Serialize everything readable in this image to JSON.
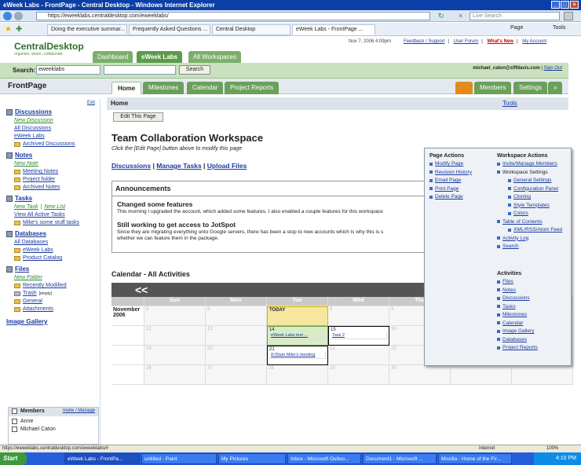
{
  "window": {
    "title": "eWeek Labs - FrontPage - Central Desktop - Windows Internet Explorer"
  },
  "browser": {
    "url": "https://eweeklabs.centraldesktop.com/eweeklabs/",
    "search_placeholder": "Live Search",
    "tabs": [
      "Doing the executive summar...",
      "Frequently Asked Questions ...",
      "Central Desktop",
      "eWeek Labs - FrontPage ..."
    ],
    "tools": [
      "Page",
      "Tools"
    ]
  },
  "app": {
    "logo": "CentralDesktop",
    "tagline": "organize, share, collaborate",
    "datetime": "Nov 7, 2006 4:09pm",
    "links": [
      "Feedback / Support",
      "User Forum",
      "What's New",
      "My Account"
    ],
    "nav_tabs": [
      "Dashboard",
      "eWeek Labs",
      "All Workspaces"
    ],
    "search_label": "Search:",
    "search_scope": "eweeklabs",
    "search_button": "Search",
    "user_email": "michael_caton@ziffdavis.com",
    "sign_out": "Sign Out",
    "page_title": "FrontPage",
    "section_tabs": [
      "Home",
      "Milestones",
      "Calendar",
      "Project Reports"
    ],
    "right_tabs": [
      "Members",
      "Settings",
      "»"
    ]
  },
  "sidebar": {
    "exit": "Exit",
    "discussions": {
      "title": "Discussions",
      "new": "New Discussion",
      "items": [
        "All Discussions",
        "eWeek Labs",
        "Archived Discussions"
      ]
    },
    "notes": {
      "title": "Notes",
      "new": "New Note",
      "items": [
        "Meeting Notes",
        "Project folder",
        "Archived Notes"
      ]
    },
    "tasks": {
      "title": "Tasks",
      "new": "New Task",
      "new_list": "New List",
      "items": [
        "View All Active Tasks",
        "Mike's some stuff tasks"
      ]
    },
    "databases": {
      "title": "Databases",
      "items": [
        "All Databases",
        "eWeek Labs",
        "Product Catalog"
      ]
    },
    "files": {
      "title": "Files",
      "new": "New Folder",
      "items": [
        "Recently Modified",
        "Trash",
        "General",
        "Attachments"
      ],
      "trash_tag": "[empty]"
    },
    "gallery": "Image Gallery",
    "members": {
      "title": "Members",
      "invite": "Invite / Manage",
      "items": [
        "Anne",
        "Michael Caton"
      ]
    }
  },
  "content": {
    "breadcrumb": "Home",
    "tools_label": "Tools",
    "edit_button": "Edit This Page",
    "title": "Team Collaboration Workspace",
    "instruction": "Click the [Edit Page] button above to modify this page",
    "quick_links": [
      "Discussions",
      "Manage Tasks",
      "Upload Files"
    ],
    "announcements": {
      "header": "Announcements",
      "items": [
        {
          "title": "Changed some features",
          "body": "This morning I upgraded the account, which added some features. I also enabled a couple features for this workspace"
        },
        {
          "title": "Still working to get access to JotSpot",
          "body": "Since they are migrating everything onto Google servers, there has been a stop to new accounts which is why this is s",
          "body2": "whether we can feature them in the package."
        }
      ]
    },
    "calendar": {
      "header": "Calendar - All Activities",
      "nav": "<<",
      "days": [
        "Sun",
        "Mon",
        "Tue",
        "Wed",
        "Thu",
        "Fri",
        "Sat"
      ],
      "month": "November 2006",
      "today_label": "TODAY",
      "weeks": [
        [
          "",
          "",
          "",
          "1",
          "2",
          "3",
          "4"
        ],
        [
          "5",
          "6",
          "7",
          "8",
          "9",
          "10",
          "11"
        ],
        [
          "12",
          "13",
          "14",
          "15",
          "16",
          "17",
          "18"
        ],
        [
          "19",
          "20",
          "21",
          "22",
          "23",
          "24",
          "25"
        ],
        [
          "26",
          "27",
          "28",
          "29",
          "30",
          "",
          ""
        ]
      ],
      "events": {
        "e14": "eWeek Labs test ...",
        "e15": "Task 2",
        "e21": "8:00am Mike's meeting"
      }
    }
  },
  "dropdown": {
    "page_actions_title": "Page Actions",
    "page_actions": [
      "Modify Page",
      "Revision History",
      "Email Page",
      "Print Page",
      "Delete Page"
    ],
    "workspace_title": "Workspace Actions",
    "workspace": [
      "Invite/Manage Members",
      "Workspace Settings",
      "General Settings",
      "Configuration Panel",
      "Cloning",
      "Style Templates",
      "Colors",
      "Table of Contents",
      "XML/RSS/Atom Feed",
      "Activity Log",
      "Search"
    ],
    "activities_title": "Activities",
    "activities": [
      "Files",
      "Notes",
      "Discussions",
      "Tasks",
      "Milestones",
      "Calendar",
      "Image Gallery",
      "Databases",
      "Project Reports"
    ]
  },
  "status": {
    "url": "https://eweeklabs.centraldesktop.com/eweeklabs/#",
    "zone": "Internet",
    "zoom": "100%"
  },
  "taskbar": {
    "start": "Start",
    "items": [
      "eWeek Labs - FrontPa...",
      "untitled - Paint",
      "My Pictures",
      "Inbox - Microsoft Outloo...",
      "Document1 - Microsoft ...",
      "Mozilla - Home of the Fir..."
    ],
    "clock": "4:10 PM"
  },
  "colors": {
    "brand_green": "#5c9a4c",
    "link_blue": "#1a3aa0",
    "titlebar": "#0b3fa8"
  }
}
